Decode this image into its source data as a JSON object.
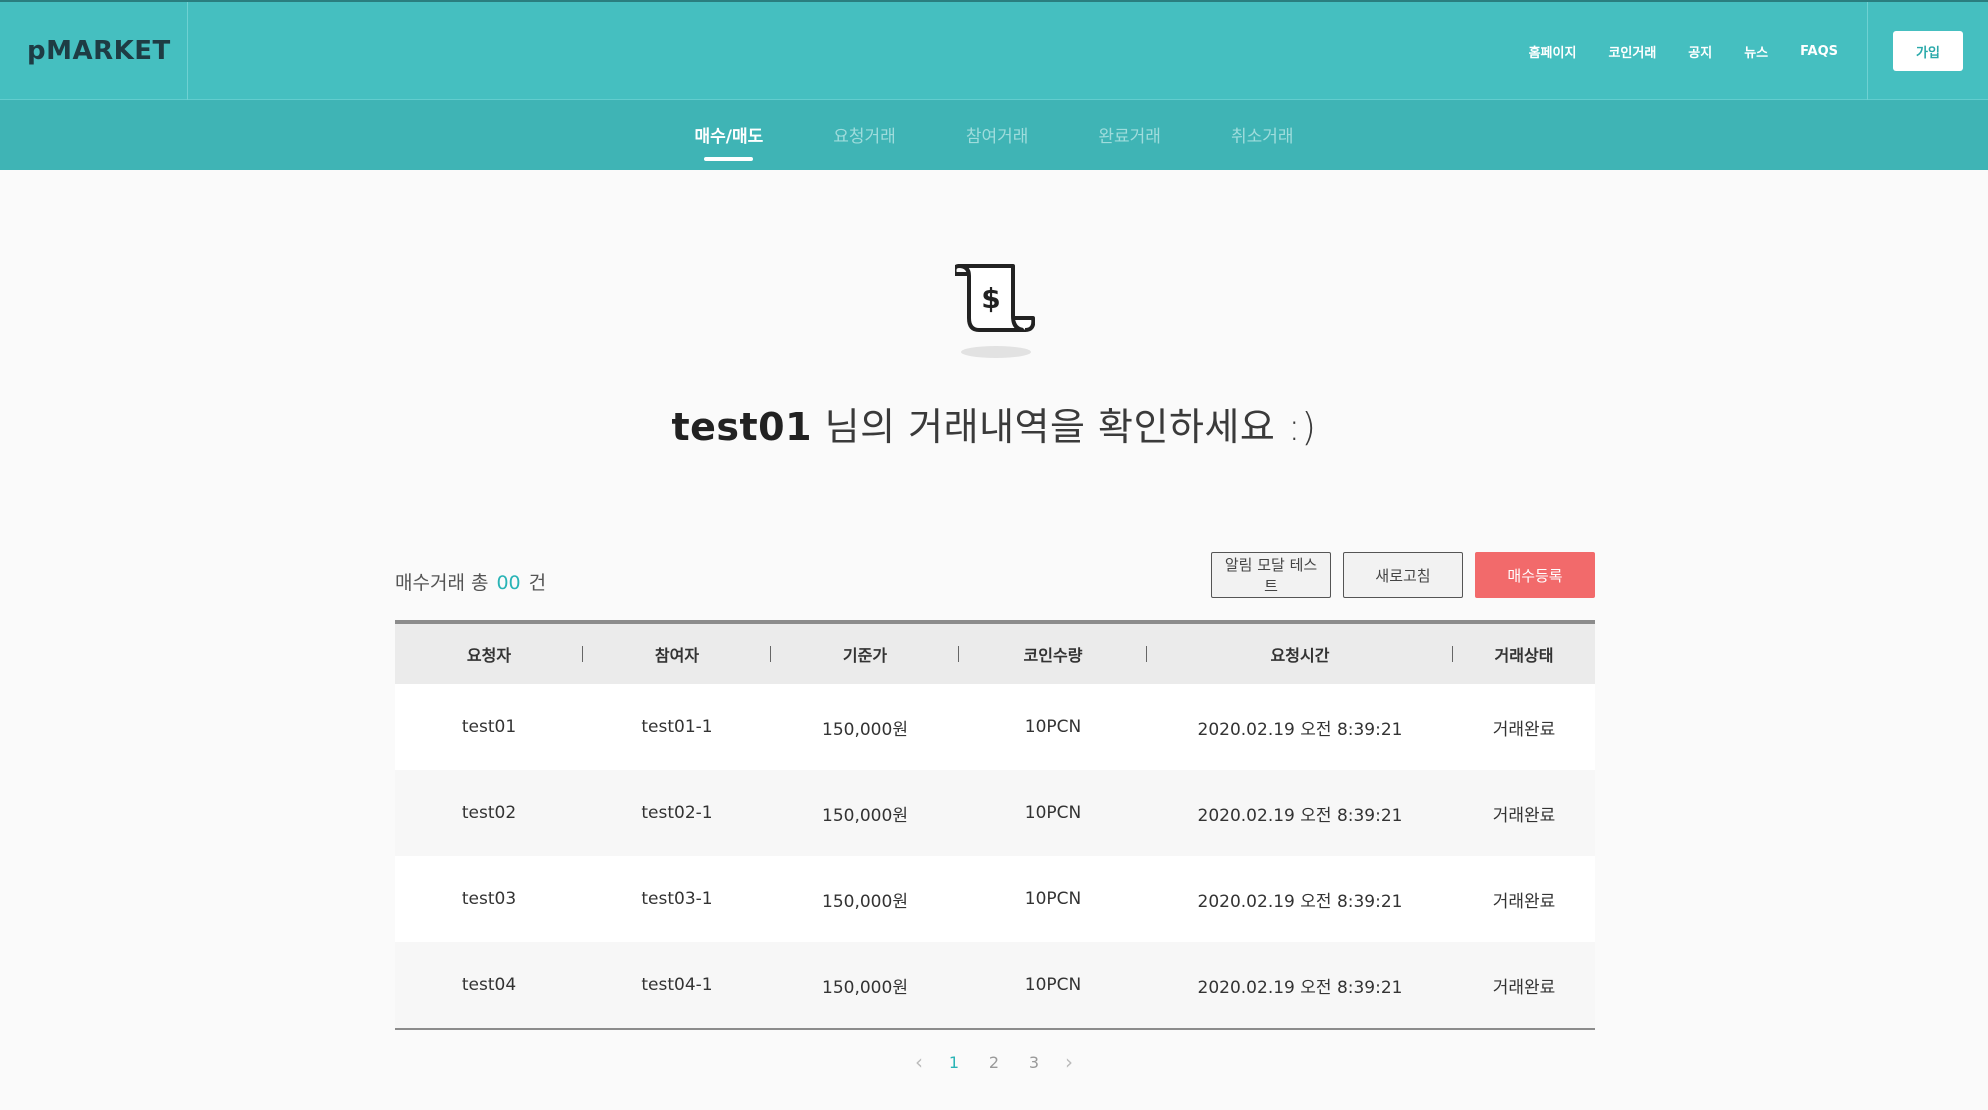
{
  "header": {
    "logo": "pMARKET",
    "nav": [
      "홈페이지",
      "코인거래",
      "공지",
      "뉴스",
      "FAQS"
    ],
    "join_label": "가입"
  },
  "subnav": {
    "tabs": [
      {
        "label": "매수/매도",
        "active": true
      },
      {
        "label": "요청거래",
        "active": false
      },
      {
        "label": "참여거래",
        "active": false
      },
      {
        "label": "완료거래",
        "active": false
      },
      {
        "label": "취소거래",
        "active": false
      }
    ]
  },
  "hero": {
    "icon": "receipt-dollar-icon",
    "username": "test01",
    "message": "님의 거래내역을 확인하세요 :)"
  },
  "summary": {
    "label": "매수거래 총",
    "count": "00",
    "unit": "건"
  },
  "actions": {
    "alert_label": "알림 모달 테스트",
    "refresh_label": "새로고침",
    "register_label": "매수등록"
  },
  "table": {
    "columns": [
      "요청자",
      "참여자",
      "기준가",
      "코인수량",
      "요청시간",
      "거래상태"
    ],
    "rows": [
      [
        "test01",
        "test01-1",
        "150,000원",
        "10PCN",
        "2020.02.19 오전 8:39:21",
        "거래완료"
      ],
      [
        "test02",
        "test02-1",
        "150,000원",
        "10PCN",
        "2020.02.19 오전 8:39:21",
        "거래완료"
      ],
      [
        "test03",
        "test03-1",
        "150,000원",
        "10PCN",
        "2020.02.19 오전 8:39:21",
        "거래완료"
      ],
      [
        "test04",
        "test04-1",
        "150,000원",
        "10PCN",
        "2020.02.19 오전 8:39:21",
        "거래완료"
      ]
    ]
  },
  "pagination": {
    "prev_icon": "chevron-left-icon",
    "pages": [
      "1",
      "2",
      "3"
    ],
    "current": "1",
    "next_icon": "chevron-right-icon"
  },
  "colors": {
    "header": "#45bfc0",
    "subnav": "#3fb4b5",
    "accent": "#2ab4b6",
    "register_button": "#f26a6b"
  }
}
